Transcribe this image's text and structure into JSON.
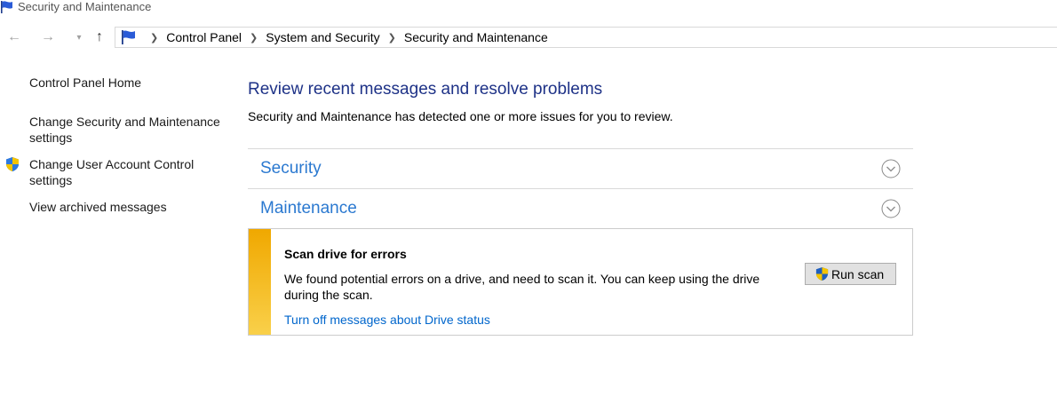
{
  "window": {
    "title": "Security and Maintenance"
  },
  "nav": {
    "back_icon": "arrow-left-icon",
    "forward_icon": "arrow-right-icon",
    "recent_icon": "chevron-down-icon",
    "up_icon": "arrow-up-icon",
    "breadcrumbs": [
      "Control Panel",
      "System and Security",
      "Security and Maintenance"
    ]
  },
  "sidebar": {
    "items": [
      {
        "label": "Control Panel Home",
        "icon": null
      },
      {
        "label": "Change Security and Maintenance settings",
        "icon": null
      },
      {
        "label": "Change User Account Control settings",
        "icon": "uac-shield-icon"
      },
      {
        "label": "View archived messages",
        "icon": null
      }
    ]
  },
  "main": {
    "headline": "Review recent messages and resolve problems",
    "subtext": "Security and Maintenance has detected one or more issues for you to review.",
    "sections": [
      {
        "label": "Security",
        "expanded": false
      },
      {
        "label": "Maintenance",
        "expanded": true
      }
    ],
    "issue": {
      "title": "Scan drive for errors",
      "description": "We found potential errors on a drive, and need to scan it. You can keep using the drive during the scan.",
      "action_button": "Run scan",
      "link": "Turn off messages about Drive status",
      "severity_color": "#f0a800"
    }
  },
  "colors": {
    "headline": "#1e3287",
    "section_label": "#2b79d0",
    "link": "#0066cc",
    "warning_stripe": "#f0a800"
  }
}
